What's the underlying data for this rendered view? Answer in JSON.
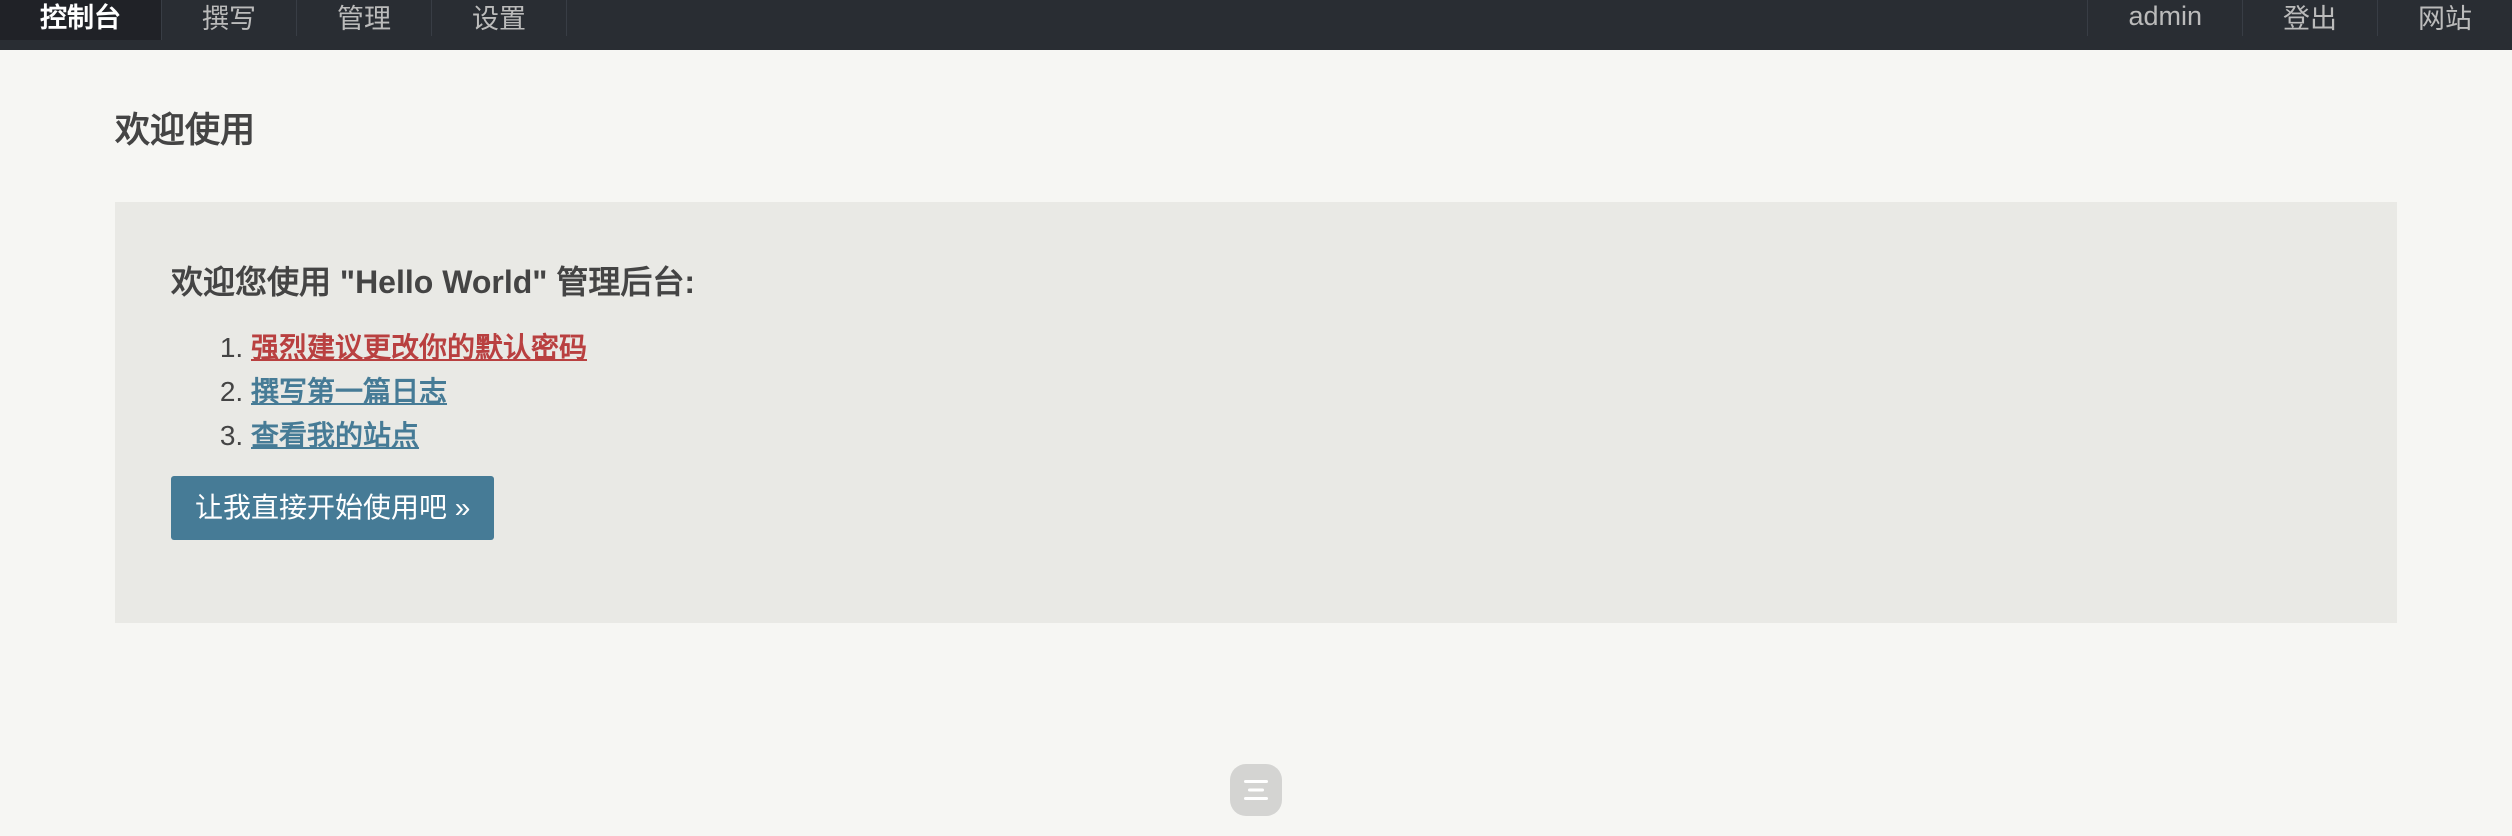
{
  "nav": {
    "left": [
      "控制台",
      "撰写",
      "管理",
      "设置"
    ],
    "right": [
      "admin",
      "登出",
      "网站"
    ]
  },
  "main": {
    "title": "欢迎使用",
    "welcome_heading": "欢迎您使用 \"Hello World\" 管理后台:",
    "tasks": [
      {
        "label": "强烈建议更改你的默认密码",
        "type": "danger"
      },
      {
        "label": "撰写第一篇日志",
        "type": "normal"
      },
      {
        "label": "查看我的站点",
        "type": "normal"
      }
    ],
    "start_button": "让我直接开始使用吧 »"
  },
  "colors": {
    "topbar": "#292d33",
    "accent": "#467b96",
    "danger": "#b94040",
    "page_background": "#f6f6f3"
  },
  "icons": {
    "floating_menu": "menu-icon"
  }
}
